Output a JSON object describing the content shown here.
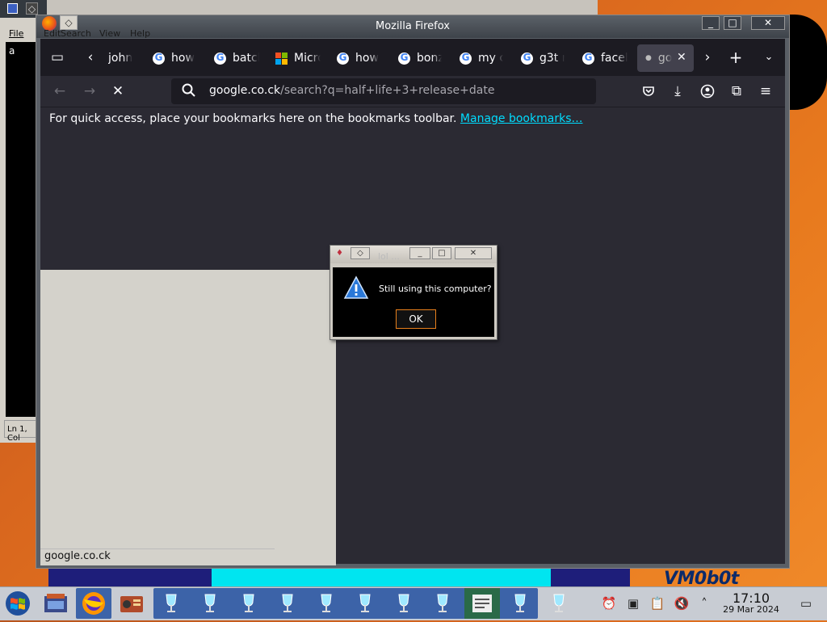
{
  "desktop": {
    "watermark": "VM0b0t"
  },
  "notepad": {
    "menu_file": "File",
    "editor_text": "a",
    "status": "Ln 1, Col"
  },
  "overlap_menu": {
    "edit": "Edit",
    "search": "Search",
    "view": "View",
    "help": "Help"
  },
  "firefox": {
    "title": "Mozilla Firefox",
    "tabs": [
      {
        "label": "john",
        "icon": "none"
      },
      {
        "label": "how",
        "icon": "google-icon"
      },
      {
        "label": "batch",
        "icon": "google-icon"
      },
      {
        "label": "Micro",
        "icon": "microsoft-icon"
      },
      {
        "label": "how",
        "icon": "google-icon"
      },
      {
        "label": "bonz",
        "icon": "google-icon"
      },
      {
        "label": "my c",
        "icon": "google-icon"
      },
      {
        "label": "g3t r",
        "icon": "google-icon"
      },
      {
        "label": "faceb",
        "icon": "google-icon"
      },
      {
        "label": "go",
        "icon": "loading-dot",
        "active": true
      }
    ],
    "url_host": "google.co.ck",
    "url_path": "/search?q=half+life+3+release+date",
    "bookmarks_hint": "For quick access, place your bookmarks here on the bookmarks toolbar.",
    "bookmarks_link": "Manage bookmarks…",
    "status_url": "google.co.ck"
  },
  "dialog": {
    "title": "lol ...",
    "message": "Still using this computer?",
    "ok_label": "OK"
  },
  "taskbar": {
    "time": "17:10",
    "date": "29 Mar 2024"
  },
  "colors": {
    "accent_link": "#00ddff",
    "dialog_ok_border": "#e8801c",
    "desktop_orange": "#e87a1e"
  }
}
